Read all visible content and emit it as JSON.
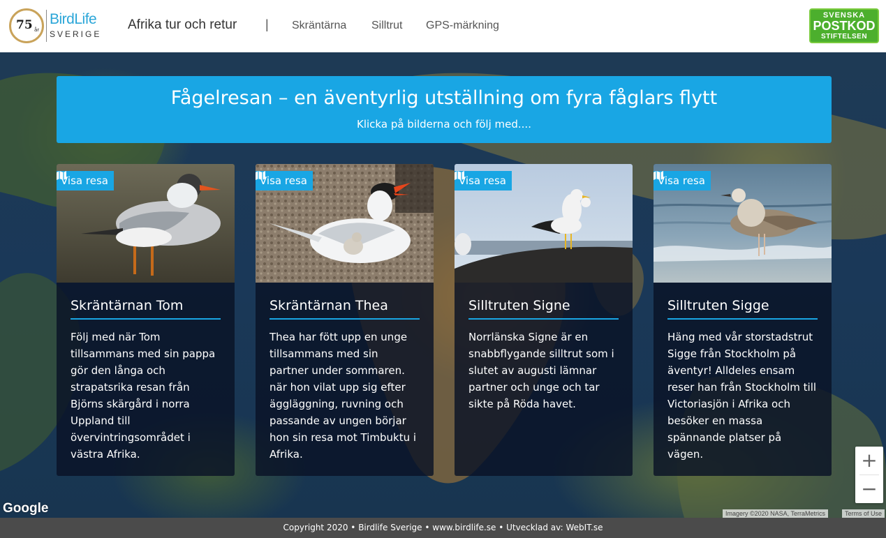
{
  "header": {
    "logo_badge_number": "75",
    "logo_badge_suffix": "år",
    "logo_name": "BirdLife",
    "logo_country": "SVERIGE",
    "nav_title": "Afrika tur och retur",
    "nav_separator": "|",
    "nav_links": [
      "Skräntärna",
      "Silltrut",
      "GPS-märkning"
    ],
    "sponsor_top": "SVENSKA",
    "sponsor_mid": "POSTKOD",
    "sponsor_bot": "STIFTELSEN"
  },
  "banner": {
    "title": "Fågelresan – en äventyrlig utställning om fyra fåglars flytt",
    "subtitle": "Klicka på bilderna och följ med...."
  },
  "cards": [
    {
      "button_label": "Visa resa",
      "title": "Skräntärnan Tom",
      "text": "Följ med när Tom tillsammans med sin pappa gör den långa och strapatsrika resan från Björns skärgård i norra Uppland till övervintringsområdet i västra Afrika."
    },
    {
      "button_label": "Visa resa",
      "title": "Skräntärnan Thea",
      "text": "Thea har fött upp en unge tillsammans med sin partner under sommaren. när hon vilat upp sig efter äggläggning, ruvning och passande av ungen börjar hon sin resa mot Timbuktu i Afrika."
    },
    {
      "button_label": "Visa resa",
      "title": "Silltruten Signe",
      "text": "Norrlänska Signe är en snabbflygande silltrut som i slutet av augusti lämnar partner och unge och tar sikte på Röda havet."
    },
    {
      "button_label": "Visa resa",
      "title": "Silltruten Sigge",
      "text": "Häng med vår storstadstrut Sigge från Stockholm på äventyr! Alldeles ensam reser han från Stockholm till Victoriasjön i Afrika och besöker en massa spännande platser på vägen."
    }
  ],
  "map": {
    "provider_logo": "Google",
    "attribution": "Imagery ©2020 NASA, TerraMetrics",
    "terms": "Terms of Use",
    "zoom_in_label": "+",
    "zoom_out_label": "−"
  },
  "footer": {
    "text": "Copyright 2020 • Birdlife Sverige • www.birdlife.se • Utvecklad av: WebIT.se"
  },
  "colors": {
    "accent": "#19a6e4",
    "card_bg": "#0a1226",
    "footer_bg": "#4b4b4b",
    "sponsor_green": "#4caf2d"
  },
  "icons": {
    "visa_button_icon": "map-icon",
    "zoom_in": "plus-icon",
    "zoom_out": "minus-icon"
  }
}
